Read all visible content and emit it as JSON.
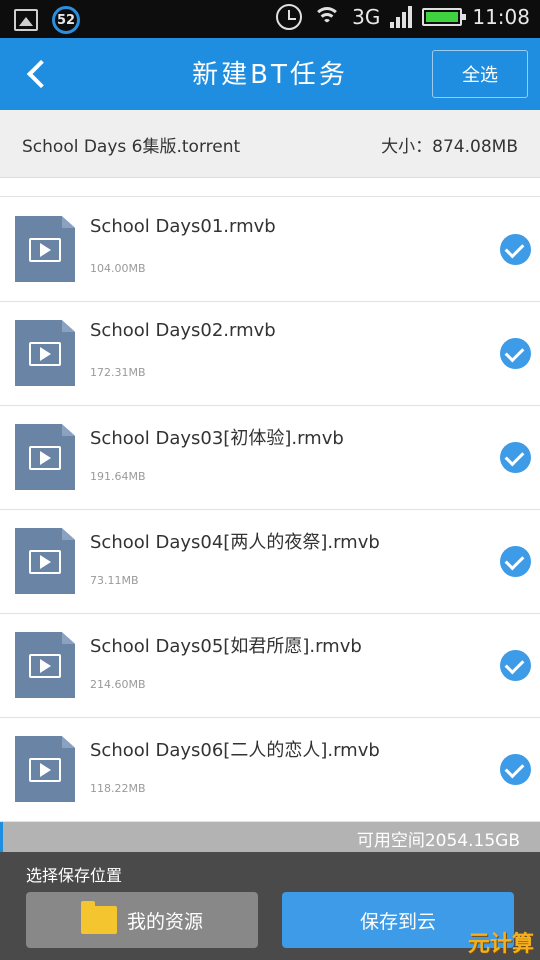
{
  "status_bar": {
    "notification_badge": "52",
    "network": "3G",
    "time": "11:08"
  },
  "header": {
    "title": "新建BT任务",
    "select_all_label": "全选"
  },
  "torrent": {
    "name": "School Days  6集版.torrent",
    "size": "大小：874.08MB"
  },
  "files": [
    {
      "name": "School Days01.rmvb",
      "size": "104.00MB",
      "checked": true
    },
    {
      "name": "School Days02.rmvb",
      "size": "172.31MB",
      "checked": true
    },
    {
      "name": "School Days03[初体验].rmvb",
      "size": "191.64MB",
      "checked": true
    },
    {
      "name": "School Days04[两人的夜祭].rmvb",
      "size": "73.11MB",
      "checked": true
    },
    {
      "name": "School Days05[如君所愿].rmvb",
      "size": "214.60MB",
      "checked": true
    },
    {
      "name": "School Days06[二人的恋人].rmvb",
      "size": "118.22MB",
      "checked": true
    }
  ],
  "storage": {
    "available": "可用空间2054.15GB"
  },
  "footer": {
    "label": "选择保存位置",
    "my_resources": "我的资源",
    "save_to_cloud": "保存到云"
  },
  "watermark": "元计算",
  "colors": {
    "header_blue": "#1f8ee0",
    "check_blue": "#3d9be7",
    "file_icon": "#6a84a6",
    "footer_bg": "#4a4a4a"
  }
}
